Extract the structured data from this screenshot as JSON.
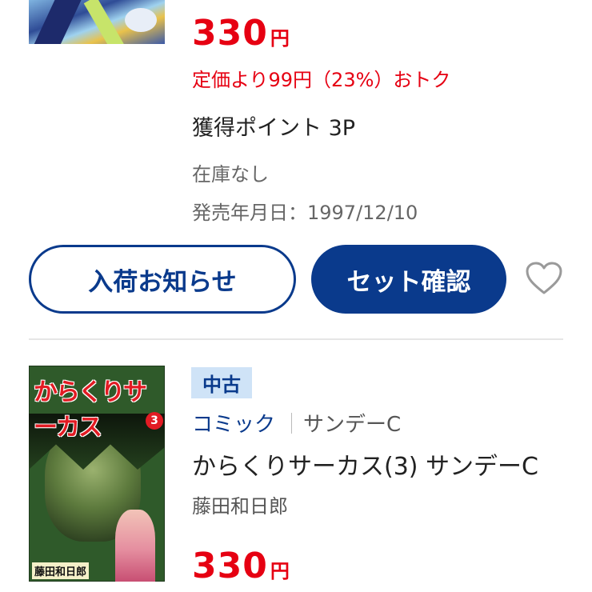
{
  "item1": {
    "price": "330",
    "price_unit": "円",
    "discount": "定価より99円（23%）おトク",
    "points": "獲得ポイント 3P",
    "stock": "在庫なし",
    "release_date": "発売年月日：1997/12/10",
    "notify_button": "入荷お知らせ",
    "set_button": "セット確認",
    "favorite_icon": "heart-outline-icon"
  },
  "item2": {
    "badge": "中古",
    "category": "コミック",
    "label": "サンデーC",
    "title": "からくりサーカス(3) サンデーC",
    "author": "藤田和日郎",
    "price": "330",
    "price_unit": "円",
    "cover": {
      "title": "からくりサーカス",
      "volume": "3",
      "author": "藤田和日郎"
    }
  },
  "colors": {
    "price_red": "#e60012",
    "brand_navy": "#0a3a8c",
    "badge_bg": "#cfe3f7"
  }
}
